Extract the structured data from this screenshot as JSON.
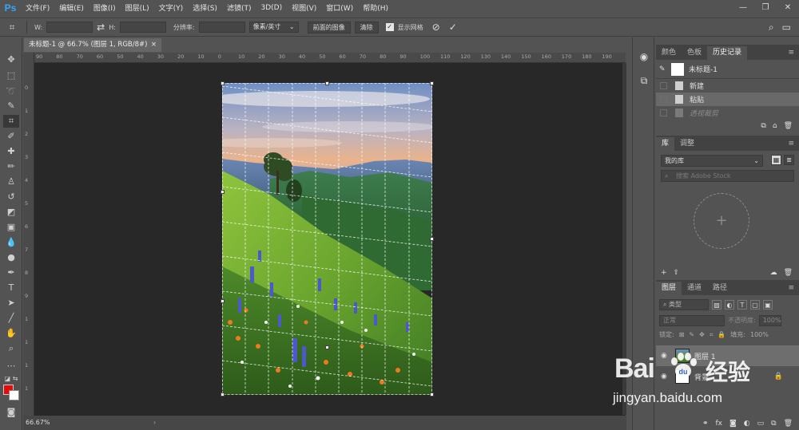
{
  "app": {
    "logo": "Ps"
  },
  "menu": [
    "文件(F)",
    "编辑(E)",
    "图像(I)",
    "图层(L)",
    "文字(Y)",
    "选择(S)",
    "滤镜(T)",
    "3D(D)",
    "视图(V)",
    "窗口(W)",
    "帮助(H)"
  ],
  "window_controls": {
    "minimize": "—",
    "restore": "❐",
    "close": "✕"
  },
  "options": {
    "w_label": "W:",
    "h_label": "H:",
    "swap": "⇄",
    "resolution_label": "分辨率:",
    "unit": "像素/英寸",
    "front_image_button": "前面的图像",
    "clear_button": "清除",
    "show_grid_label": "显示网格",
    "show_grid_checked": true,
    "cancel_icon": "⊘",
    "commit_icon": "✓"
  },
  "document": {
    "tab_title": "未标题-1 @ 66.7% (图层 1, RGB/8#) *",
    "tab_close": "×",
    "zoom": "66.67%",
    "ruler_h": [
      "90",
      "80",
      "70",
      "60",
      "50",
      "40",
      "30",
      "20",
      "10",
      "0",
      "10",
      "20",
      "30",
      "40",
      "50",
      "60",
      "70",
      "80",
      "90",
      "100",
      "110",
      "120",
      "130",
      "140",
      "150",
      "160",
      "170",
      "180",
      "190"
    ],
    "ruler_v": [
      "0",
      "1",
      "2",
      "3",
      "4",
      "5",
      "6",
      "7",
      "8",
      "9",
      "1",
      "1",
      "1",
      "1"
    ]
  },
  "history_panel": {
    "tabs": [
      "颜色",
      "色板",
      "历史记录"
    ],
    "active_tab": "历史记录",
    "snapshot": "未标题-1",
    "items": [
      {
        "label": "新建",
        "state": "normal"
      },
      {
        "label": "粘贴",
        "state": "selected"
      },
      {
        "label": "透视裁剪",
        "state": "dim"
      }
    ]
  },
  "library_panel": {
    "tabs": [
      "库",
      "调整"
    ],
    "active_tab": "库",
    "library_select": "我的库",
    "search_placeholder": "搜索 Adobe Stock",
    "add_icon": "+"
  },
  "layers_panel": {
    "tabs": [
      "图层",
      "通道",
      "路径"
    ],
    "active_tab": "图层",
    "filter_kind": "类型",
    "blend_mode": "正常",
    "opacity_label": "不透明度:",
    "opacity_value": "100%",
    "lock_label": "锁定:",
    "fill_label": "填充:",
    "fill_value": "100%",
    "layers": [
      {
        "name": "图层 1",
        "selected": true
      },
      {
        "name": "背景",
        "selected": false
      }
    ]
  },
  "watermark": {
    "brand": "Bai",
    "brand_cn": "经验",
    "url": "jingyan.baidu.com"
  },
  "colors": {
    "foreground": "#e80a0a",
    "background": "#ffffff",
    "ui_dark": "#282828",
    "ui_panel": "#535353",
    "ps_blue": "#31a8ff"
  }
}
